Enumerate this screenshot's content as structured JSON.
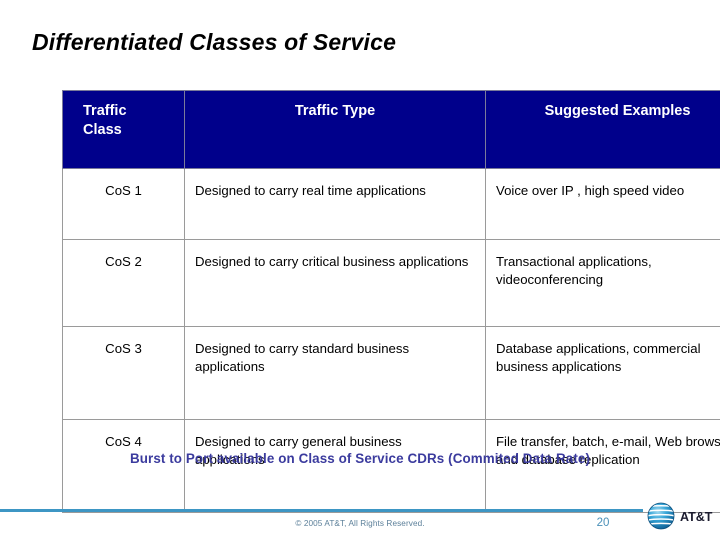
{
  "slide": {
    "title": "Differentiated Classes of Service"
  },
  "table": {
    "headers": {
      "class": "Traffic\nClass",
      "class_line1": "Traffic",
      "class_line2": "Class",
      "type": "Traffic Type",
      "examples": "Suggested Examples"
    },
    "header_bg": "#00008b",
    "header_text_color": "#ffffff",
    "border_color": "#9a9a9a",
    "rows": [
      {
        "class": "CoS 1",
        "type": "Designed to carry real time applications",
        "examples": "Voice over IP , high speed video"
      },
      {
        "class": "CoS 2",
        "type": "Designed to carry critical business applications",
        "examples": "Transactional applications, videoconferencing"
      },
      {
        "class": "CoS 3",
        "type": "Designed to carry standard business applications",
        "examples": "Database applications, commercial business applications"
      },
      {
        "class": "CoS 4",
        "type": "Designed to carry general business applications",
        "examples": "File transfer, batch, e-mail, Web browsing and database replication"
      }
    ]
  },
  "footnote": {
    "text": "Burst to Port available on Class of Service CDRs (Commited Data Rate)",
    "color": "#3b3b9e"
  },
  "footer": {
    "copyright": "© 2005 AT&T, All Rights Reserved.",
    "page_number": "20",
    "rule_color": "#3d96c4",
    "logo_wordmark": "AT&T"
  }
}
